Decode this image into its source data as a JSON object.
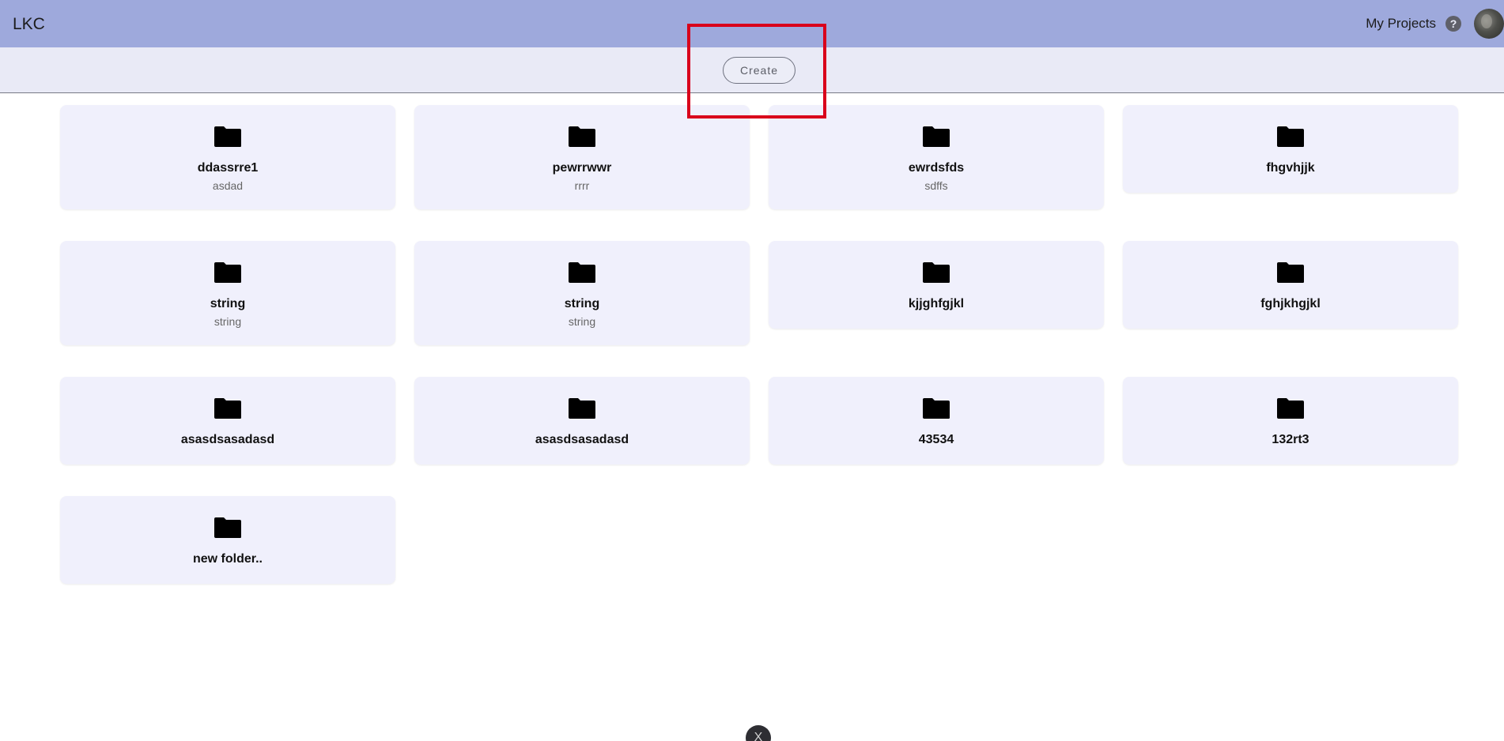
{
  "app": {
    "brand": "LKC"
  },
  "nav": {
    "my_projects": "My Projects",
    "help_glyph": "?"
  },
  "toolbar": {
    "create_label": "Create"
  },
  "folders": [
    {
      "title": "ddassrre1",
      "subtitle": "asdad"
    },
    {
      "title": "pewrrwwr",
      "subtitle": "rrrr"
    },
    {
      "title": "ewrdsfds",
      "subtitle": "sdffs"
    },
    {
      "title": "fhgvhjjk",
      "subtitle": ""
    },
    {
      "title": "string",
      "subtitle": "string"
    },
    {
      "title": "string",
      "subtitle": "string"
    },
    {
      "title": "kjjghfgjkl",
      "subtitle": ""
    },
    {
      "title": "fghjkhgjkl",
      "subtitle": ""
    },
    {
      "title": "asasdsasadasd",
      "subtitle": ""
    },
    {
      "title": "asasdsasadasd",
      "subtitle": ""
    },
    {
      "title": "43534",
      "subtitle": ""
    },
    {
      "title": "132rt3",
      "subtitle": ""
    },
    {
      "title": "new folder..",
      "subtitle": ""
    }
  ],
  "bottom_chip": {
    "glyph": "X"
  },
  "colors": {
    "navbar": "#9ea9dc",
    "toolbar": "#e9eaf6",
    "card": "#f0f0fc",
    "highlight": "#d9001b"
  },
  "icons": {
    "folder": "folder-icon",
    "help": "help-icon",
    "avatar": "avatar"
  }
}
